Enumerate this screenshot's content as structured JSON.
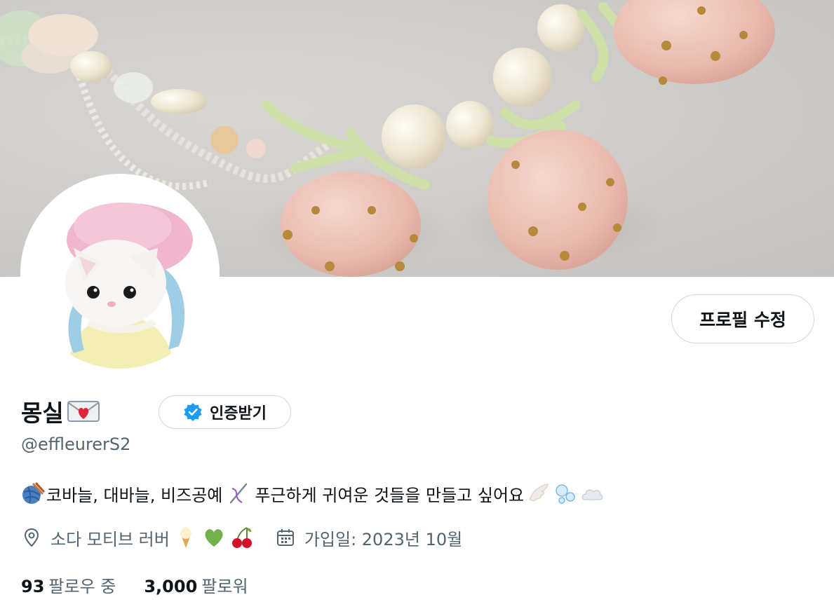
{
  "profile": {
    "display_name": "몽실",
    "handle": "@effleurerS2",
    "edit_label": "프로필 수정",
    "verify_label": "인증받기",
    "bio": {
      "text_1": "코바늘, 대바늘, 비즈공예",
      "text_2": "푸근하게 귀여운 것들을 만들고 싶어요"
    },
    "location": "소다 모티브 러버",
    "joined": "가입일: 2023년 10월",
    "following_count": "93",
    "following_label": "팔로우 중",
    "followers_count": "3,000",
    "followers_label": "팔로워"
  },
  "icons": {
    "location": "location-pin-icon",
    "calendar": "calendar-icon",
    "verified": "verified-badge-icon"
  },
  "colors": {
    "text_primary": "#0f1419",
    "text_secondary": "#536471",
    "border": "#cfd9de",
    "verified_blue": "#1d9bf0"
  }
}
